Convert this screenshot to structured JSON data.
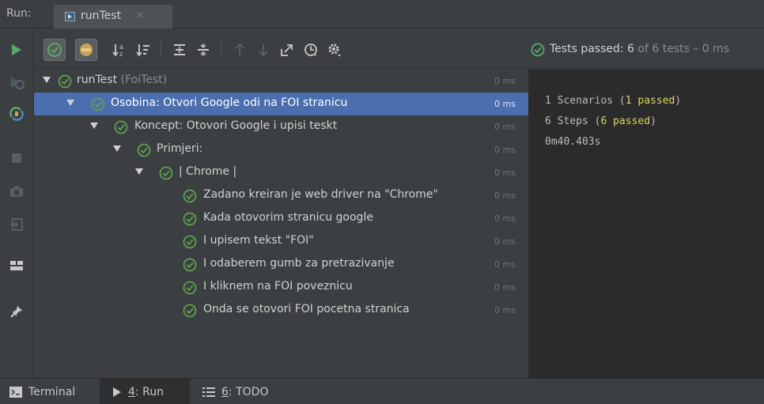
{
  "header": {
    "run_label": "Run:",
    "tab_title": "runTest",
    "tab_close": "×"
  },
  "status": {
    "label": "Tests passed:",
    "count": "6",
    "of_text": "of 6 tests – 0 ms"
  },
  "tree": {
    "rows": [
      {
        "label": "runTest",
        "suffix": "(FoiTest)",
        "duration": "0 ms"
      },
      {
        "label": "Osobina: Otvori Google odi na FOI stranicu",
        "duration": "0 ms"
      },
      {
        "label": "Koncept: Otovori Google i upisi teskt",
        "duration": "0 ms"
      },
      {
        "label": "Primjeri:",
        "duration": "0 ms"
      },
      {
        "label": "| Chrome |",
        "duration": "0 ms"
      },
      {
        "label": "Zadano kreiran je web driver na \"Chrome\"",
        "duration": "0 ms"
      },
      {
        "label": "Kada otovorim stranicu google",
        "duration": "0 ms"
      },
      {
        "label": "I upisem tekst \"FOI\"",
        "duration": "0 ms"
      },
      {
        "label": "I odaberem gumb za pretrazivanje",
        "duration": "0 ms"
      },
      {
        "label": "I kliknem na FOI poveznicu",
        "duration": "0 ms"
      },
      {
        "label": "Onda se otovori FOI pocetna stranica",
        "duration": "0 ms"
      }
    ]
  },
  "console": {
    "line1_prefix": "1 Scenarios (",
    "line1_hl": "1 passed",
    "line1_suffix": ")",
    "line2_prefix": "6 Steps (",
    "line2_hl": "6 passed",
    "line2_suffix": ")",
    "line3": "0m40.403s"
  },
  "bottom": {
    "terminal": "Terminal",
    "run_num": "4",
    "run_label": ": Run",
    "todo_num": "6",
    "todo_label": ": TODO"
  },
  "colors": {
    "pass_green": "#5f9e4f",
    "selection": "#4b6eaf",
    "console_highlight": "#d8d85a"
  }
}
